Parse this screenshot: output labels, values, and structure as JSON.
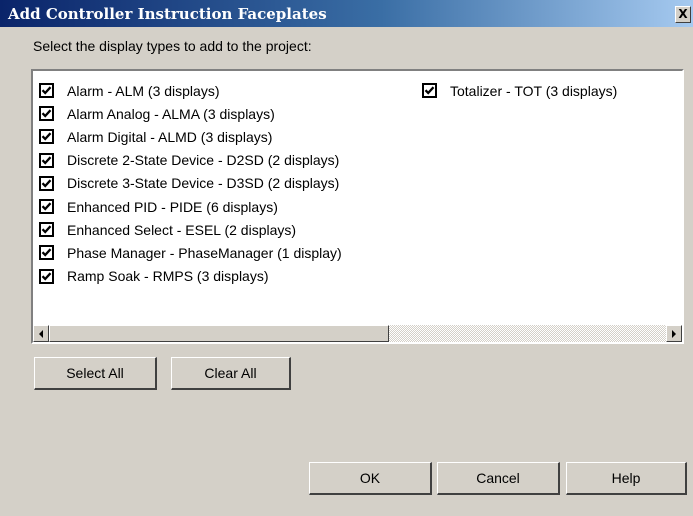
{
  "dialog": {
    "title": "Add Controller Instruction Faceplates",
    "close_glyph": "X",
    "prompt": "Select the display types to add to the project:"
  },
  "list": {
    "column1": [
      {
        "label": "Alarm - ALM (3 displays)",
        "checked": true
      },
      {
        "label": "Alarm Analog - ALMA (3 displays)",
        "checked": true
      },
      {
        "label": "Alarm Digital - ALMD (3 displays)",
        "checked": true
      },
      {
        "label": "Discrete 2-State Device - D2SD (2 displays)",
        "checked": true
      },
      {
        "label": "Discrete 3-State Device - D3SD (2 displays)",
        "checked": true
      },
      {
        "label": "Enhanced PID - PIDE (6 displays)",
        "checked": true
      },
      {
        "label": "Enhanced Select - ESEL (2 displays)",
        "checked": true
      },
      {
        "label": "Phase Manager - PhaseManager (1 display)",
        "checked": true
      },
      {
        "label": "Ramp Soak - RMPS (3 displays)",
        "checked": true
      }
    ],
    "column2": [
      {
        "label": "Totalizer - TOT (3 displays)",
        "checked": true
      }
    ]
  },
  "buttons": {
    "select_all": "Select All",
    "clear_all": "Clear All",
    "ok": "OK",
    "cancel": "Cancel",
    "help": "Help"
  },
  "icons": {
    "checkbox": "checkmark-icon",
    "close": "close-icon",
    "scroll_left": "arrow-left-icon",
    "scroll_right": "arrow-right-icon"
  }
}
